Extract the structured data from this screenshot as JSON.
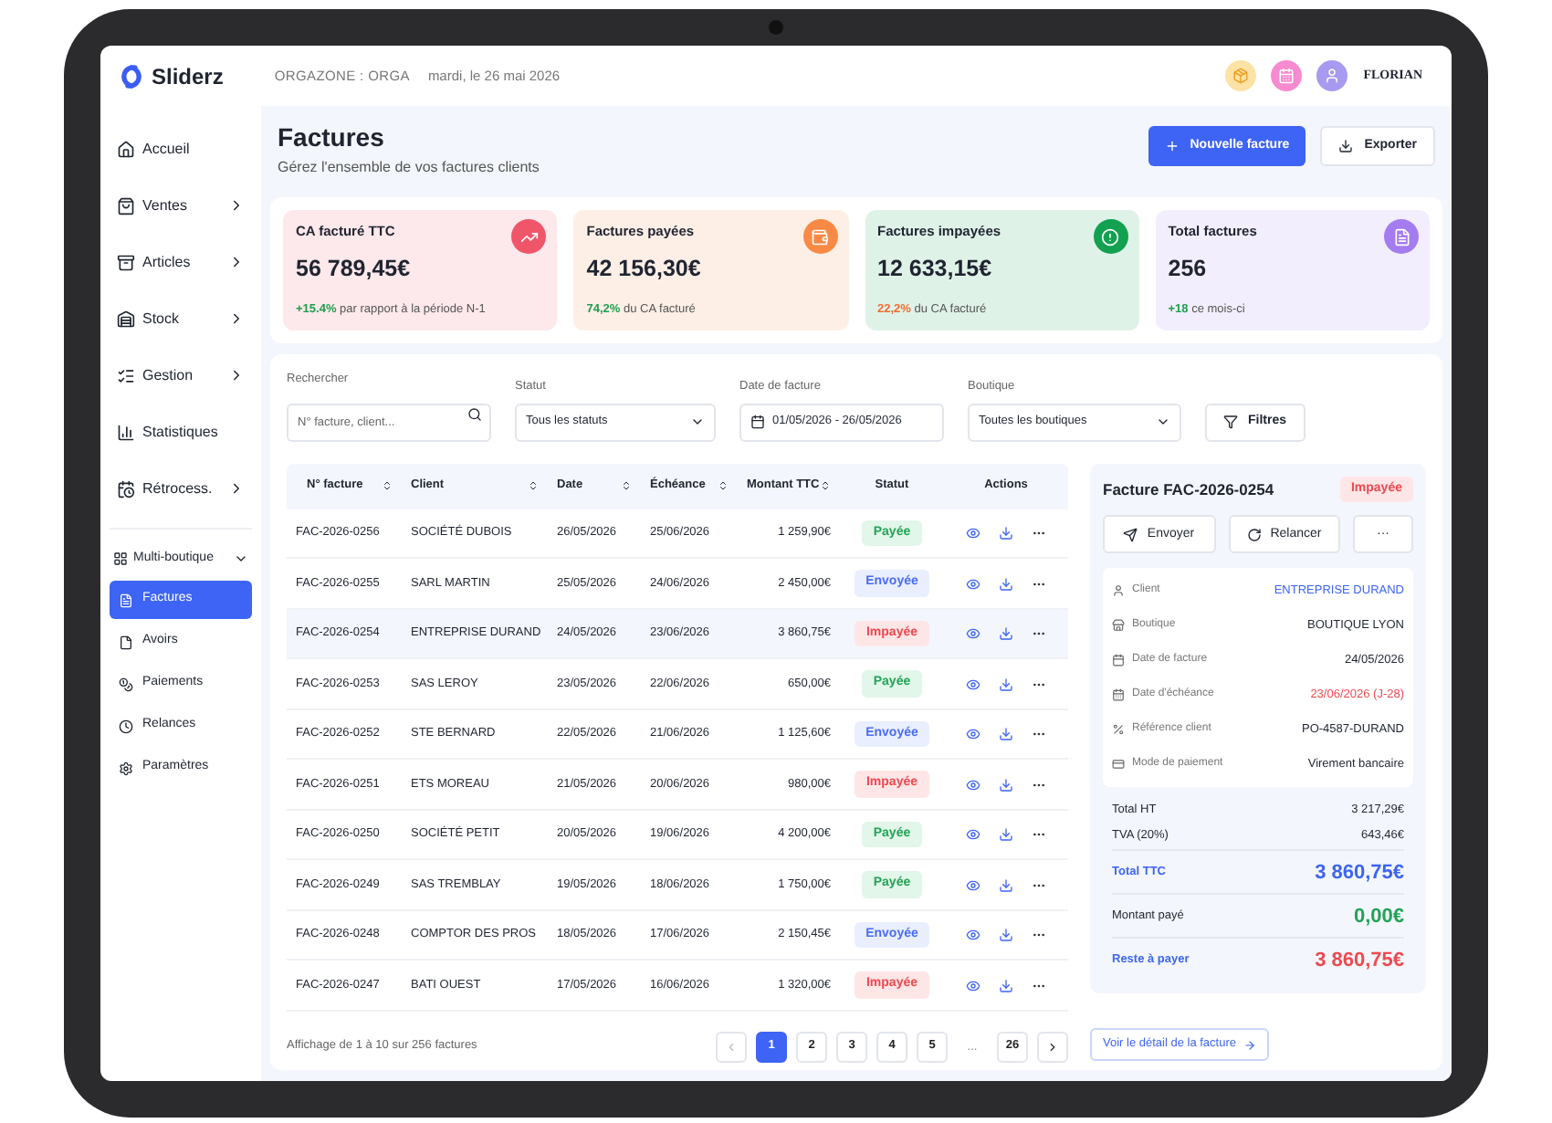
{
  "header": {
    "logo": "Sliderz",
    "org": "ORGAZONE : ORGA",
    "date": "mardi, le 26 mai 2026",
    "user": "FLORIAN"
  },
  "sidebar": {
    "items": [
      {
        "label": "Accueil",
        "kind": "link",
        "selected": false
      },
      {
        "label": "Ventes",
        "kind": "menu",
        "selected": false
      },
      {
        "label": "Articles",
        "kind": "menu",
        "selected": false
      },
      {
        "label": "Stock",
        "kind": "menu",
        "selected": false
      },
      {
        "label": "Gestion",
        "kind": "menu",
        "selected": false
      },
      {
        "label": "Statistiques",
        "kind": "link",
        "selected": false
      },
      {
        "label": "Rétrocess.",
        "kind": "menu",
        "selected": false
      }
    ],
    "group": {
      "label": "Multi-boutique",
      "expanded": true,
      "children": [
        {
          "label": "Factures",
          "selected": true
        },
        {
          "label": "Avoirs",
          "selected": false
        },
        {
          "label": "Paiements",
          "selected": false
        },
        {
          "label": "Relances",
          "selected": false
        },
        {
          "label": "Paramètres",
          "selected": false
        }
      ]
    }
  },
  "page": {
    "title": "Factures",
    "subtitle": "Gérez l'ensemble de vos factures clients",
    "buttons": [
      {
        "label": "Nouvelle facture",
        "kind": "primary"
      },
      {
        "label": "Exporter",
        "kind": "secondary"
      }
    ]
  },
  "stats": [
    {
      "label": "CA facturé TTC",
      "value": "56 789,45€",
      "delta": "+15.4%",
      "note": "par rapport à la période N-1",
      "color": "#f0566a",
      "kind": "good"
    },
    {
      "label": "Factures payées",
      "value": "42 156,30€",
      "delta": "74,2%",
      "note": "du CA facturé",
      "color": "#f98a45",
      "kind": "good"
    },
    {
      "label": "Factures impayées",
      "value": "12 633,15€",
      "delta": "22,2%",
      "note": "du CA facturé",
      "color": "#12a150",
      "kind": "bad"
    },
    {
      "label": "Total factures",
      "value": "256",
      "delta": "+18",
      "note": "ce mois-ci",
      "color": "#a47cf0",
      "kind": "good"
    }
  ],
  "filters": [
    {
      "label": "Rechercher",
      "kind": "search",
      "placeholder": "N° facture, client..."
    },
    {
      "label": "Statut",
      "kind": "select",
      "value": "Tous les statuts"
    },
    {
      "label": "Date de facture",
      "kind": "date",
      "value": "01/05/2026 - 26/05/2026"
    },
    {
      "label": "Boutique",
      "kind": "select",
      "value": "Toutes les boutiques"
    }
  ],
  "filter_button": "Filtres",
  "table": {
    "columns": [
      {
        "label": "N° facture",
        "sortable": true
      },
      {
        "label": "Client",
        "sortable": true
      },
      {
        "label": "Date",
        "sortable": true
      },
      {
        "label": "Échéance",
        "sortable": true
      },
      {
        "label": "Montant TTC",
        "sortable": true
      },
      {
        "label": "Statut",
        "sortable": false
      },
      {
        "label": "Actions",
        "sortable": false
      }
    ],
    "rows": [
      {
        "number": "FAC-2026-0256",
        "client": "SOCIÉTÉ DUBOIS",
        "date": "26/05/2026",
        "due": "25/06/2026",
        "amount": "1 259,90€",
        "status": "Payée",
        "kind": "paid",
        "selected": false
      },
      {
        "number": "FAC-2026-0255",
        "client": "SARL MARTIN",
        "date": "25/05/2026",
        "due": "24/06/2026",
        "amount": "2 450,00€",
        "status": "Envoyée",
        "kind": "sent",
        "selected": false
      },
      {
        "number": "FAC-2026-0254",
        "client": "ENTREPRISE DURAND",
        "date": "24/05/2026",
        "due": "23/06/2026",
        "amount": "3 860,75€",
        "status": "Impayée",
        "kind": "unpaid",
        "selected": true
      },
      {
        "number": "FAC-2026-0253",
        "client": "SAS LEROY",
        "date": "23/05/2026",
        "due": "22/06/2026",
        "amount": "650,00€",
        "status": "Payée",
        "kind": "paid",
        "selected": false
      },
      {
        "number": "FAC-2026-0252",
        "client": "STE BERNARD",
        "date": "22/05/2026",
        "due": "21/06/2026",
        "amount": "1 125,60€",
        "status": "Envoyée",
        "kind": "sent",
        "selected": false
      },
      {
        "number": "FAC-2026-0251",
        "client": "ETS MOREAU",
        "date": "21/05/2026",
        "due": "20/06/2026",
        "amount": "980,00€",
        "status": "Impayée",
        "kind": "unpaid",
        "selected": false
      },
      {
        "number": "FAC-2026-0250",
        "client": "SOCIÉTÉ PETIT",
        "date": "20/05/2026",
        "due": "19/06/2026",
        "amount": "4 200,00€",
        "status": "Payée",
        "kind": "paid",
        "selected": false
      },
      {
        "number": "FAC-2026-0249",
        "client": "SAS TREMBLAY",
        "date": "19/05/2026",
        "due": "18/06/2026",
        "amount": "1 750,00€",
        "status": "Payée",
        "kind": "paid",
        "selected": false
      },
      {
        "number": "FAC-2026-0248",
        "client": "COMPTOR DES PROS",
        "date": "18/05/2026",
        "due": "17/06/2026",
        "amount": "2 150,45€",
        "status": "Envoyée",
        "kind": "sent",
        "selected": false
      },
      {
        "number": "FAC-2026-0247",
        "client": "BATI OUEST",
        "date": "17/05/2026",
        "due": "16/06/2026",
        "amount": "1 320,00€",
        "status": "Impayée",
        "kind": "unpaid",
        "selected": false
      }
    ]
  },
  "pagination": {
    "info": "Affichage de 1 à 10 sur 256 factures",
    "pages": [
      {
        "label": "1",
        "selected": true,
        "kind": "page"
      },
      {
        "label": "2",
        "selected": false,
        "kind": "page"
      },
      {
        "label": "3",
        "selected": false,
        "kind": "page"
      },
      {
        "label": "4",
        "selected": false,
        "kind": "page"
      },
      {
        "label": "5",
        "selected": false,
        "kind": "page"
      },
      {
        "label": "...",
        "selected": false,
        "kind": "gap"
      },
      {
        "label": "26",
        "selected": false,
        "kind": "page"
      }
    ],
    "prev_disabled": true
  },
  "detail": {
    "title": "Facture FAC-2026-0254",
    "status": "Impayée",
    "kind": "unpaid",
    "actions": [
      {
        "label": "Envoyer",
        "kind": "send"
      },
      {
        "label": "Relancer",
        "kind": "remind"
      },
      {
        "label": "···",
        "kind": "more"
      }
    ],
    "fields": [
      {
        "label": "Client",
        "value": "ENTREPRISE DURAND",
        "kind": "link"
      },
      {
        "label": "Boutique",
        "value": "BOUTIQUE LYON",
        "kind": "normal"
      },
      {
        "label": "Date de facture",
        "value": "24/05/2026",
        "kind": "normal"
      },
      {
        "label": "Date d'échéance",
        "value": "23/06/2026 (J-28)",
        "kind": "danger"
      },
      {
        "label": "Référence client",
        "value": "PO-4587-DURAND",
        "kind": "normal"
      },
      {
        "label": "Mode de paiement",
        "value": "Virement bancaire",
        "kind": "normal"
      }
    ],
    "totals": [
      {
        "label": "Total HT",
        "value": "3 217,29€",
        "kind": "sub"
      },
      {
        "label": "TVA (20%)",
        "value": "643,46€",
        "kind": "sub"
      },
      {
        "label": "Total TTC",
        "value": "3 860,75€",
        "kind": "total"
      },
      {
        "label": "Montant payé",
        "value": "0,00€",
        "kind": "paid"
      },
      {
        "label": "Reste à payer",
        "value": "3 860,75€",
        "kind": "due"
      }
    ],
    "link": "Voir le détail de la facture"
  }
}
